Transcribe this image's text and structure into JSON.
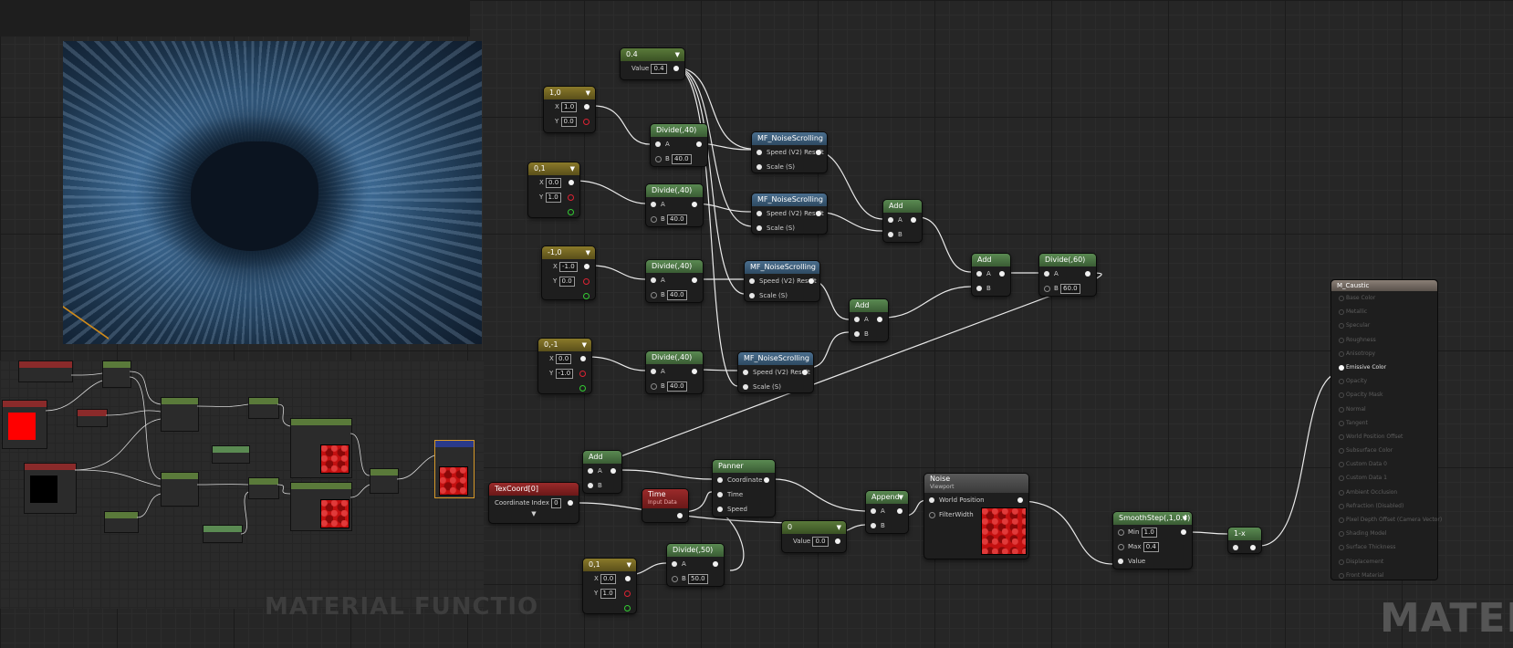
{
  "watermarks": {
    "sub": "MATERIAL FUNCTIO",
    "main": "MATER"
  },
  "nodes": {
    "const_0_4": {
      "title": "0.4",
      "label": "Value",
      "value": "0.4"
    },
    "v1": {
      "title": "1,0",
      "x_label": "X",
      "x": "1.0",
      "y_label": "Y",
      "y": "0.0"
    },
    "v2": {
      "title": "0,1",
      "x_label": "X",
      "x": "0.0",
      "y_label": "Y",
      "y": "1.0"
    },
    "v3": {
      "title": "-1,0",
      "x_label": "X",
      "x": "-1.0",
      "y_label": "Y",
      "y": "0.0"
    },
    "v4": {
      "title": "0,-1",
      "x_label": "X",
      "x": "0.0",
      "y_label": "Y",
      "y": "-1.0"
    },
    "v5": {
      "title": "0,1",
      "x_label": "X",
      "x": "0.0",
      "y_label": "Y",
      "y": "1.0"
    },
    "div1": {
      "title": "Divide(,40)",
      "a": "A",
      "b": "B",
      "bval": "40.0"
    },
    "div2": {
      "title": "Divide(,40)",
      "a": "A",
      "b": "B",
      "bval": "40.0"
    },
    "div3": {
      "title": "Divide(,40)",
      "a": "A",
      "b": "B",
      "bval": "40.0"
    },
    "div4": {
      "title": "Divide(,40)",
      "a": "A",
      "b": "B",
      "bval": "40.0"
    },
    "div50": {
      "title": "Divide(,50)",
      "a": "A",
      "b": "B",
      "bval": "50.0"
    },
    "div60": {
      "title": "Divide(,60)",
      "a": "A",
      "b": "B",
      "bval": "60.0"
    },
    "mf1": {
      "title": "MF_NoiseScrolling",
      "speed": "Speed (V2)",
      "result": "Result",
      "scale": "Scale (S)"
    },
    "mf2": {
      "title": "MF_NoiseScrolling",
      "speed": "Speed (V2)",
      "result": "Result",
      "scale": "Scale (S)"
    },
    "mf3": {
      "title": "MF_NoiseScrolling",
      "speed": "Speed (V2)",
      "result": "Result",
      "scale": "Scale (S)"
    },
    "mf4": {
      "title": "MF_NoiseScrolling",
      "speed": "Speed (V2)",
      "result": "Result",
      "scale": "Scale (S)"
    },
    "add1": {
      "title": "Add",
      "a": "A",
      "b": "B"
    },
    "add2": {
      "title": "Add",
      "a": "A",
      "b": "B"
    },
    "add3": {
      "title": "Add",
      "a": "A",
      "b": "B"
    },
    "add4": {
      "title": "Add",
      "a": "A",
      "b": "B"
    },
    "texcoord": {
      "title": "TexCoord[0]",
      "label": "Coordinate Index",
      "value": "0"
    },
    "time": {
      "title": "Time",
      "sub": "Input Data"
    },
    "panner": {
      "title": "Panner",
      "coordinate": "Coordinate",
      "time": "Time",
      "speed": "Speed"
    },
    "append": {
      "title": "Append",
      "a": "A",
      "b": "B"
    },
    "const_0": {
      "title": "0",
      "label": "Value",
      "value": "0.0"
    },
    "noise": {
      "title": "Noise",
      "sub": "Viewport",
      "world": "World Position",
      "filter": "FilterWidth"
    },
    "smooth": {
      "title": "SmoothStep(,1,0.4)",
      "min_label": "Min",
      "min": "1.0",
      "max_label": "Max",
      "max": "0.4",
      "value": "Value"
    },
    "onex": {
      "title": "1-x"
    }
  },
  "material": {
    "title": "M_Caustic",
    "inputs": [
      "Base Color",
      "Metallic",
      "Specular",
      "Roughness",
      "Anisotropy",
      "Emissive Color",
      "Opacity",
      "Opacity Mask",
      "Normal",
      "Tangent",
      "World Position Offset",
      "Subsurface Color",
      "Custom Data 0",
      "Custom Data 1",
      "Ambient Occlusion",
      "Refraction (Disabled)",
      "Pixel Depth Offset (Camera Vector)",
      "Shading Model",
      "Surface Thickness",
      "Displacement",
      "Front Material"
    ],
    "active": "Emissive Color"
  },
  "colors": {
    "accent_wire": "#f0f0f0",
    "preview": "#c41010",
    "material_header": "#8a7f76"
  }
}
